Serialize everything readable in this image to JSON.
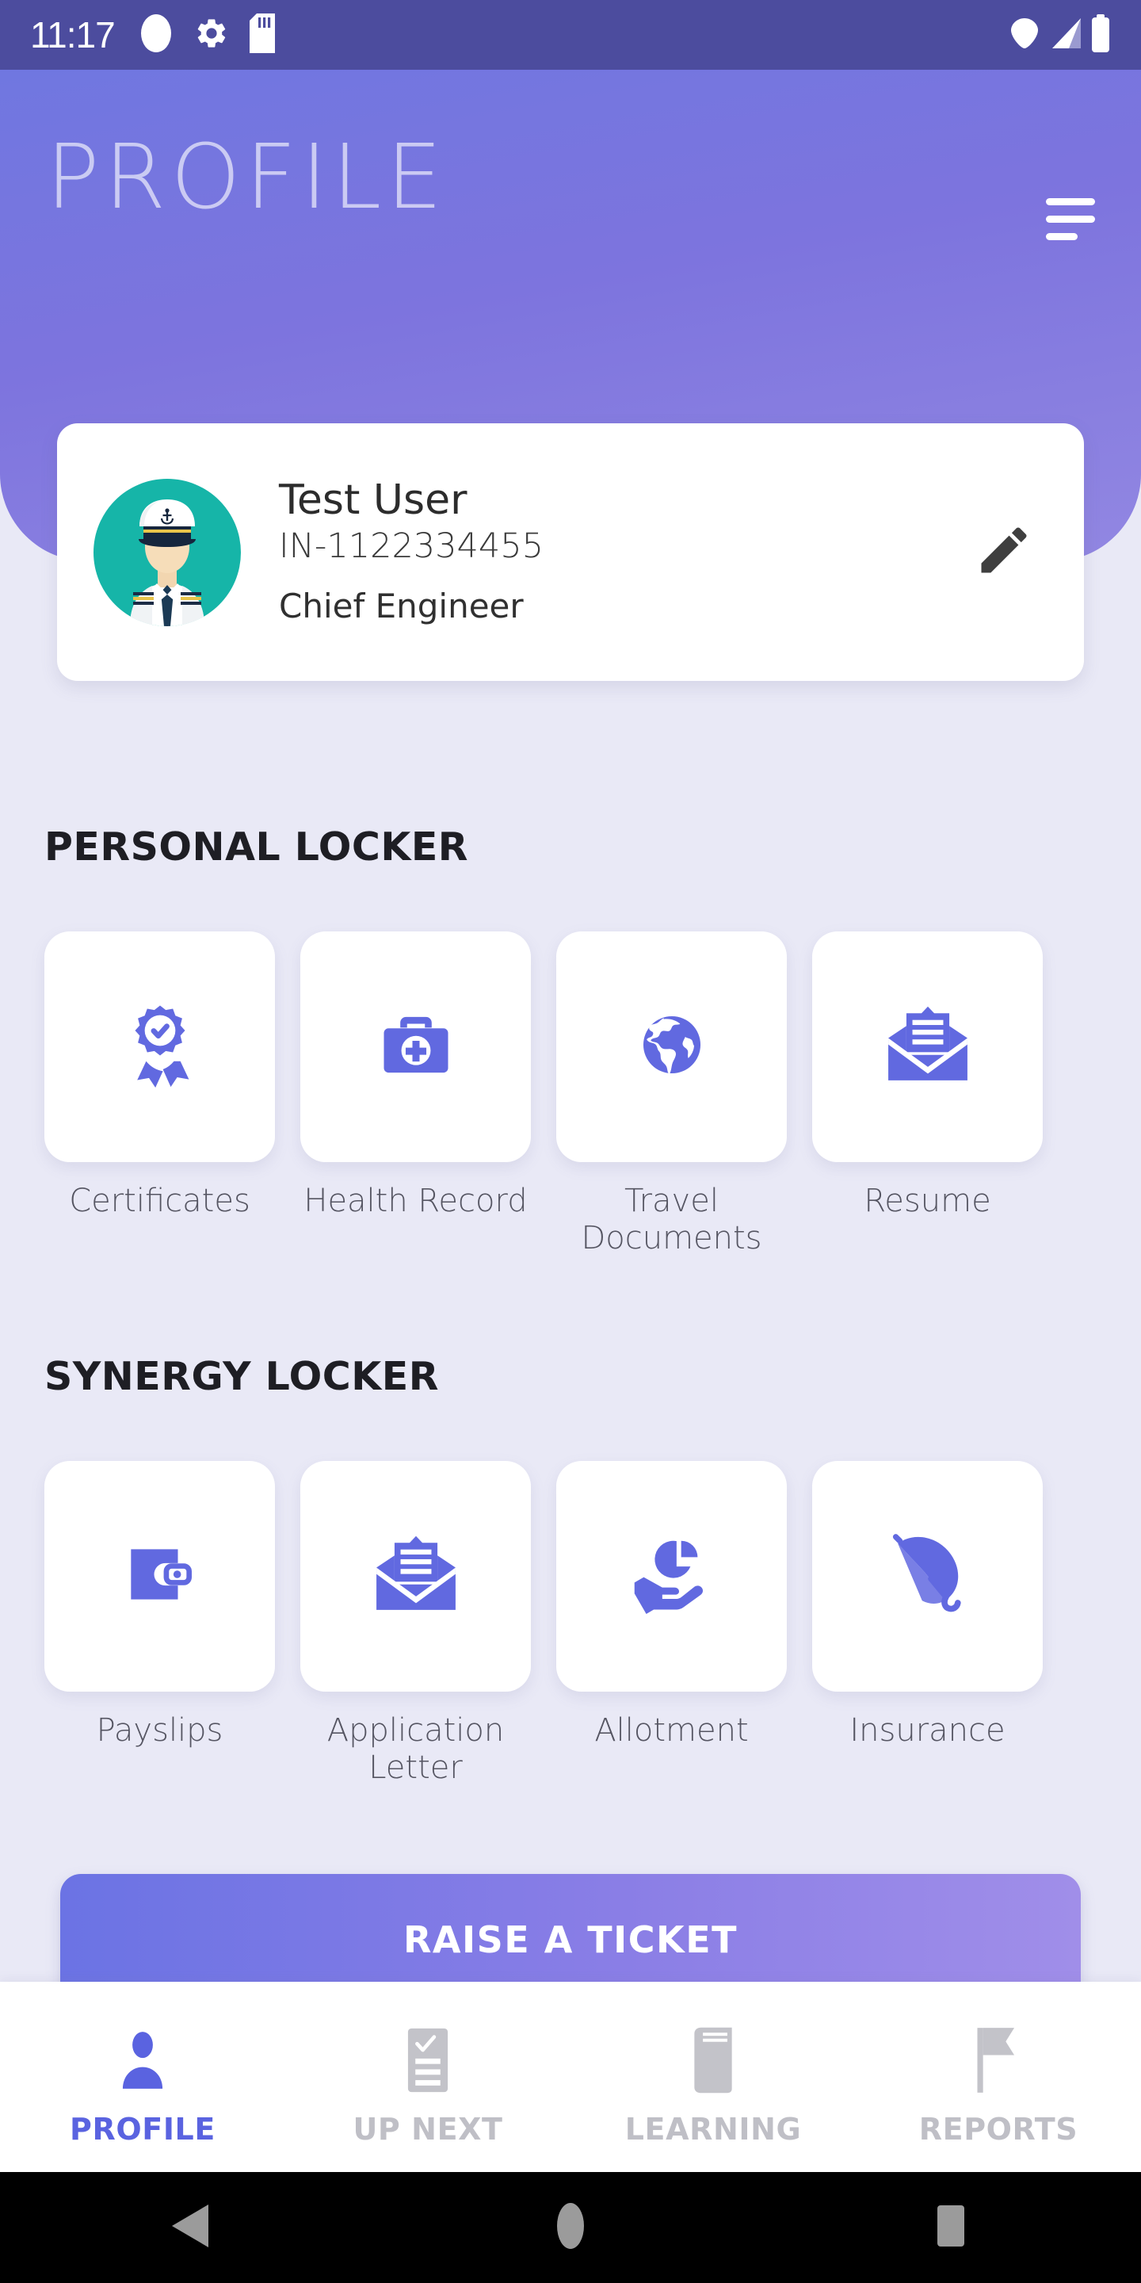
{
  "statusbar": {
    "time": "11:17",
    "left_icons": [
      "circle-icon",
      "gear-icon",
      "sdcard-icon"
    ],
    "right_icons": [
      "wifi-icon",
      "cellular-signal-icon",
      "battery-icon"
    ],
    "background": "#4c4c9e"
  },
  "header": {
    "title": "PROFILE",
    "menu_icon": "hamburger-menu-icon",
    "gradient_from": "#7077e0",
    "gradient_to": "#9287e2"
  },
  "profile": {
    "avatar_icon": "naval-officer-avatar",
    "avatar_bg": "#16b5a8",
    "name": "Test User",
    "id": "IN-1122334455",
    "rank": "Chief Engineer",
    "edit_icon": "pencil-edit-icon"
  },
  "personal_locker": {
    "title": "PERSONAL LOCKER",
    "items": [
      {
        "label": "Certificates",
        "icon": "certificate-badge-icon"
      },
      {
        "label": "Health Record",
        "icon": "medical-kit-icon"
      },
      {
        "label": "Travel\nDocuments",
        "icon": "globe-icon"
      },
      {
        "label": "Resume",
        "icon": "open-envelope-document-icon"
      }
    ]
  },
  "synergy_locker": {
    "title": "SYNERGY LOCKER",
    "items": [
      {
        "label": "Payslips",
        "icon": "wallet-icon"
      },
      {
        "label": "Application\nLetter",
        "icon": "envelope-letter-icon"
      },
      {
        "label": "Allotment",
        "icon": "hand-pie-chart-icon"
      },
      {
        "label": "Insurance",
        "icon": "umbrella-icon"
      }
    ]
  },
  "ticket_button": {
    "label": "RAISE A TICKET"
  },
  "bottom_nav": {
    "active_color": "#5a63e0",
    "inactive_color": "#bfbfc6",
    "items": [
      {
        "label": "PROFILE",
        "icon": "person-icon",
        "active": true
      },
      {
        "label": "UP NEXT",
        "icon": "checklist-icon",
        "active": false
      },
      {
        "label": "LEARNING",
        "icon": "book-icon",
        "active": false
      },
      {
        "label": "REPORTS",
        "icon": "flag-icon",
        "active": false
      }
    ]
  },
  "system_nav": {
    "back_icon": "back-triangle-icon",
    "home_icon": "home-circle-icon",
    "recents_icon": "recents-square-icon"
  },
  "accent": "#6269e0",
  "icon_blue": "#6169e0",
  "page_bg": "#e9e9f6"
}
